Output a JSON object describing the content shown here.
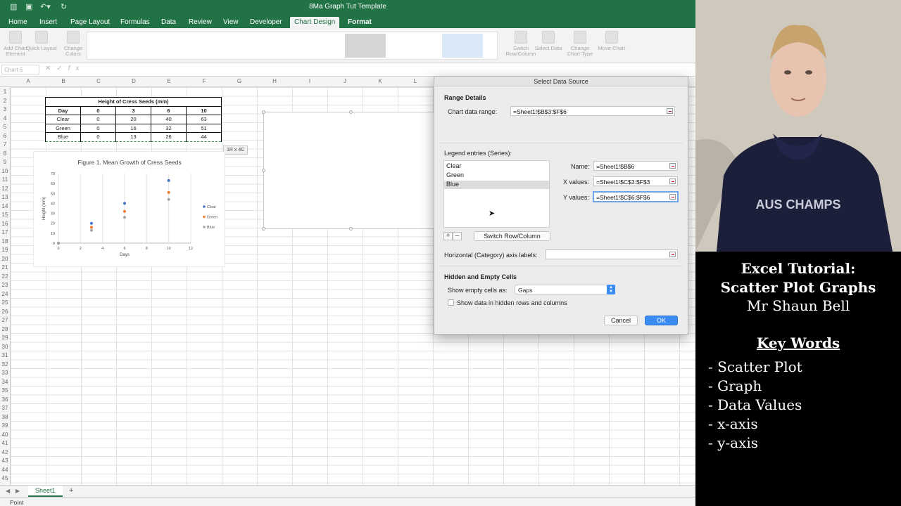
{
  "window": {
    "title": "8Ma Graph Tut Template"
  },
  "ribbon_tabs": [
    "Home",
    "Insert",
    "Page Layout",
    "Formulas",
    "Data",
    "Review",
    "View",
    "Developer",
    "Chart Design",
    "Format"
  ],
  "active_tab": "Chart Design",
  "ribbon": {
    "add_chart_element": "Add Chart Element",
    "quick_layout": "Quick Layout",
    "change_colors": "Change Colors",
    "switch_row_column": "Switch Row/Column",
    "select_data": "Select Data",
    "change_chart_type": "Change Chart Type",
    "move_chart": "Move Chart"
  },
  "formula_bar": {
    "name_box": "Chart 6",
    "fx": "fx"
  },
  "columns": [
    "A",
    "B",
    "C",
    "D",
    "E",
    "F",
    "G",
    "H",
    "I",
    "J",
    "K",
    "L"
  ],
  "rows": [
    "1",
    "2",
    "3",
    "4",
    "5",
    "6",
    "7",
    "8",
    "9",
    "10",
    "11",
    "12",
    "13",
    "14",
    "15",
    "16",
    "17",
    "18",
    "19",
    "20",
    "21",
    "22",
    "23",
    "24",
    "25",
    "26",
    "27",
    "28",
    "29",
    "30",
    "31",
    "32",
    "33",
    "34",
    "35",
    "36",
    "37",
    "38",
    "39",
    "40",
    "41",
    "42",
    "43",
    "44",
    "45"
  ],
  "table": {
    "title": "Height of Cress Seeds (mm)",
    "header": [
      "Day",
      "0",
      "3",
      "6",
      "10"
    ],
    "rows": [
      [
        "Clear",
        "0",
        "20",
        "40",
        "63"
      ],
      [
        "Green",
        "0",
        "16",
        "32",
        "51"
      ],
      [
        "Blue",
        "0",
        "13",
        "26",
        "44"
      ]
    ]
  },
  "chart_data": {
    "type": "scatter",
    "title": "Figure 1. Mean Growth of Cress Seeds",
    "xlabel": "Days",
    "ylabel": "Height (mm)",
    "xlim": [
      0,
      12
    ],
    "ylim": [
      0,
      70
    ],
    "xticks": [
      0,
      2,
      4,
      6,
      8,
      10,
      12
    ],
    "yticks": [
      0,
      10,
      20,
      30,
      40,
      50,
      60,
      70
    ],
    "grid": "vertical",
    "legend": "right",
    "series": [
      {
        "name": "Clear",
        "color": "#4472c4",
        "points": [
          [
            0,
            0
          ],
          [
            3,
            20
          ],
          [
            6,
            40
          ],
          [
            10,
            63
          ]
        ]
      },
      {
        "name": "Green",
        "color": "#ed7d31",
        "points": [
          [
            0,
            0
          ],
          [
            3,
            16
          ],
          [
            6,
            32
          ],
          [
            10,
            51
          ]
        ]
      },
      {
        "name": "Blue",
        "color": "#a5a5a5",
        "points": [
          [
            0,
            0
          ],
          [
            3,
            13
          ],
          [
            6,
            26
          ],
          [
            10,
            44
          ]
        ]
      }
    ]
  },
  "size_tip": "1R x 4C",
  "dialog": {
    "title": "Select Data Source",
    "range_details": "Range Details",
    "chart_range_label": "Chart data range:",
    "chart_range_value": "=Sheet1!$B$3:$F$6",
    "legend_entries_label": "Legend entries (Series):",
    "series": [
      "Clear",
      "Green",
      "Blue"
    ],
    "selected_series": "Blue",
    "name_label": "Name:",
    "name_value": "=Sheet1!$B$6",
    "x_label": "X values:",
    "x_value": "=Sheet1!$C$3:$F$3",
    "y_label": "Y values:",
    "y_value": "=Sheet1!$C$6:$F$6",
    "add": "+",
    "remove": "–",
    "switch_button": "Switch Row/Column",
    "horizontal_axis_label": "Horizontal (Category) axis labels:",
    "horizontal_axis_value": "",
    "hidden_section": "Hidden and Empty Cells",
    "show_empty_label": "Show empty cells as:",
    "show_empty_value": "Gaps",
    "hidden_rows_label": "Show data in hidden rows and columns",
    "hidden_rows_checked": false,
    "cancel": "Cancel",
    "ok": "OK"
  },
  "sheet_tab": "Sheet1",
  "status": "Point",
  "caption": {
    "title_line1": "Excel Tutorial:",
    "title_line2": "Scatter Plot Graphs",
    "author": "Mr Shaun Bell",
    "keywords_heading": "Key Words",
    "keywords": [
      "- Scatter Plot",
      "- Graph",
      "- Data Values",
      "- x-axis",
      "- y-axis"
    ]
  },
  "presenter_shirt_text": "AUS CHAMPS"
}
